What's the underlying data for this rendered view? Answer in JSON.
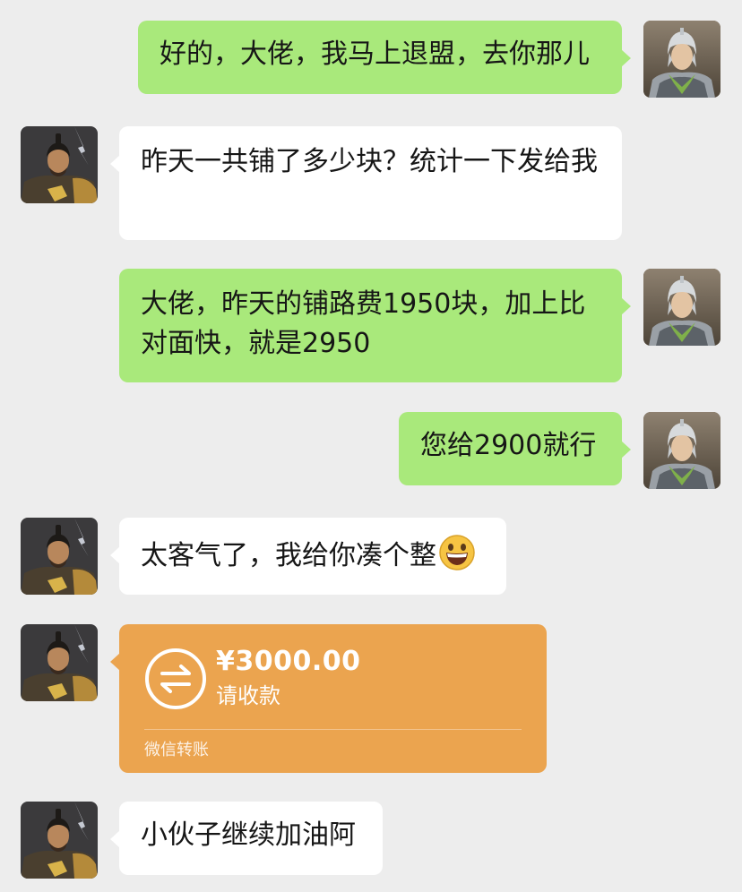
{
  "messages": [
    {
      "sender": "self",
      "text": "好的，大佬，我马上退盟，去你那儿"
    },
    {
      "sender": "other",
      "text": "昨天一共铺了多少块？统计一下发给我"
    },
    {
      "sender": "self",
      "text": "大佬，昨天的铺路费1950块，加上比对面快，就是2950"
    },
    {
      "sender": "self",
      "text": "您给2900就行"
    },
    {
      "sender": "other",
      "text": "太客气了，我给你凑个整",
      "emoji": "grinning-face-icon"
    },
    {
      "sender": "other",
      "type": "transfer",
      "amount": "¥3000.00",
      "status": "请收款",
      "footer": "微信转账"
    },
    {
      "sender": "other",
      "text": "小伙子继续加油阿"
    }
  ],
  "colors": {
    "background": "#ededed",
    "self_bubble": "#a9e97b",
    "other_bubble": "#ffffff",
    "transfer_bubble": "#eba44f"
  },
  "avatars": {
    "self": "armored-warrior-avatar-silver-helmet",
    "other": "warrior-lord-avatar-dark"
  }
}
